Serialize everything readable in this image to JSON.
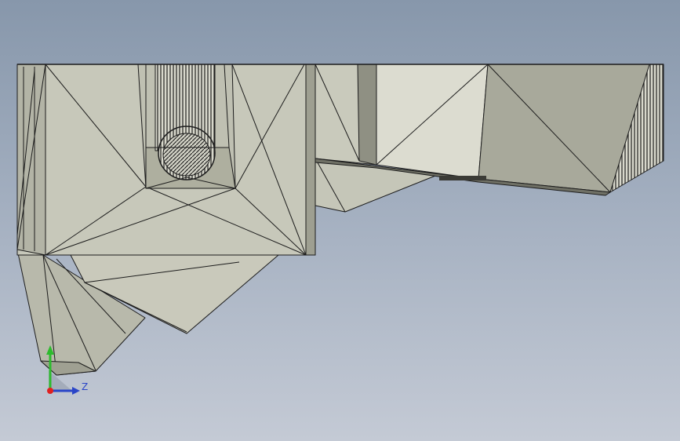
{
  "viewport": {
    "background_top": "#8797ab",
    "background_bottom": "#c4cad5"
  },
  "model": {
    "icon": "cad-wireframe-part",
    "face_light": "#d4d4c6",
    "face_mid": "#c2c3b5",
    "face_dark": "#a9aa9c",
    "edge_color": "#1c1c1c"
  },
  "triad": {
    "icon": "coordinate-triad-icon",
    "z_label": "Z",
    "x_color": "#e02020",
    "y_color": "#2dbb2d",
    "z_color": "#2a45c8"
  }
}
